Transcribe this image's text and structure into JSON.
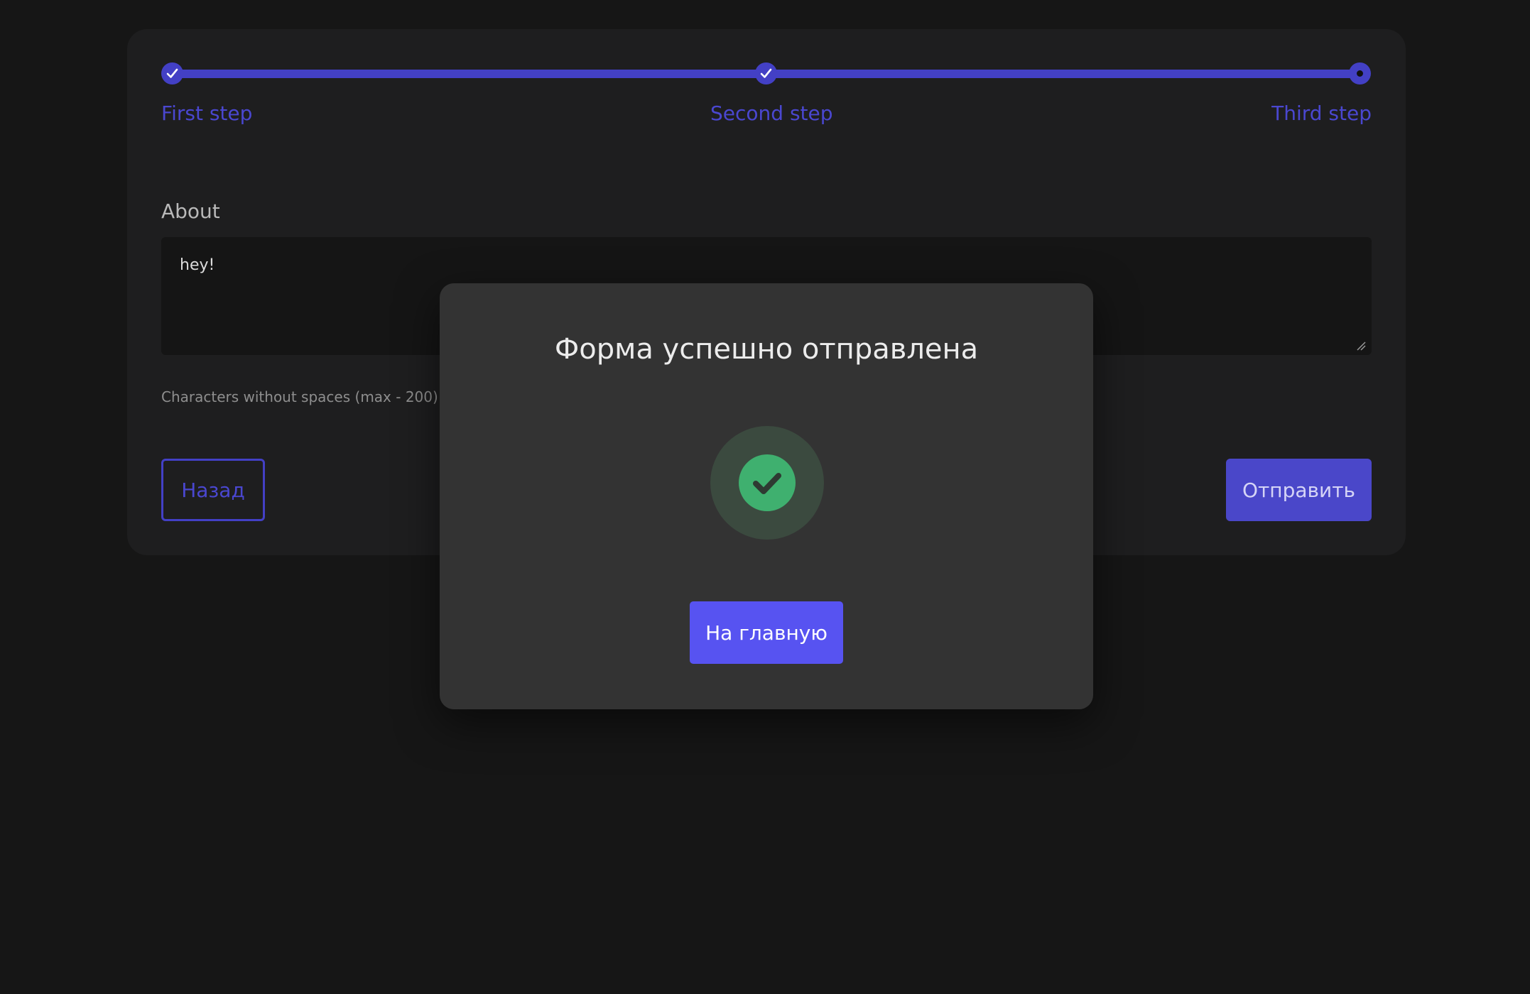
{
  "stepper": {
    "steps": [
      {
        "label": "First step",
        "state": "completed"
      },
      {
        "label": "Second step",
        "state": "completed"
      },
      {
        "label": "Third step",
        "state": "current"
      }
    ],
    "progress": 1.0,
    "accent_color": "#4340c5"
  },
  "form": {
    "about_label": "About",
    "about_value": "hey!",
    "char_count_text": "Characters without spaces (max - 200): 4",
    "back_label": "Назад",
    "submit_label": "Отправить"
  },
  "modal": {
    "title": "Форма успешно отправлена",
    "icon": "check-circle-icon",
    "success_color": "#3fb06f",
    "home_label": "На главную",
    "home_button_color": "#5753f1"
  }
}
